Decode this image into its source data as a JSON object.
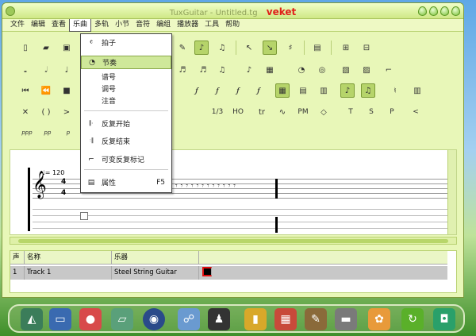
{
  "window": {
    "title": "TuxGuitar - Untitled.tg",
    "badge": "veket"
  },
  "menubar": [
    "文件",
    "编辑",
    "查看",
    "乐曲",
    "多轨",
    "小节",
    "音符",
    "编组",
    "播放器",
    "工具",
    "帮助"
  ],
  "active_menu_index": 3,
  "dropdown": {
    "items": [
      {
        "label": "拍子",
        "icon": "time-signature-icon",
        "shortcut": ""
      },
      {
        "label": "节奏",
        "icon": "tempo-icon",
        "shortcut": "",
        "highlighted": true
      },
      {
        "label": "谱号",
        "icon": "",
        "shortcut": ""
      },
      {
        "label": "调号",
        "icon": "",
        "shortcut": ""
      },
      {
        "label": "注音",
        "icon": "",
        "shortcut": ""
      },
      {
        "label": "反复开始",
        "icon": "repeat-open-icon",
        "shortcut": ""
      },
      {
        "label": "反复结束",
        "icon": "repeat-close-icon",
        "shortcut": ""
      },
      {
        "label": "可变反复标记",
        "icon": "alternate-ending-icon",
        "shortcut": ""
      },
      {
        "label": "属性",
        "icon": "properties-icon",
        "shortcut": "F5"
      }
    ]
  },
  "score": {
    "tempo": "= 120",
    "time_sig_top": "4",
    "time_sig_bottom": "4"
  },
  "tracks": {
    "headers": [
      "声",
      "名称",
      "乐器"
    ],
    "rows": [
      {
        "number": "1",
        "name": "Track 1",
        "instrument": "Steel String Guitar",
        "color": "#000000"
      }
    ]
  },
  "toolbar_row4_labels": [
    "T",
    "S",
    "P",
    "<"
  ],
  "toolbar_row5_labels": [
    "ppp",
    "pp",
    "p"
  ],
  "toolbar_row4_extra": [
    "1/3",
    "HO",
    "PM"
  ],
  "colors": {
    "accent": "#cfe89a",
    "window_bg": "#e8f7b8",
    "title_badge": "#e0201a"
  }
}
